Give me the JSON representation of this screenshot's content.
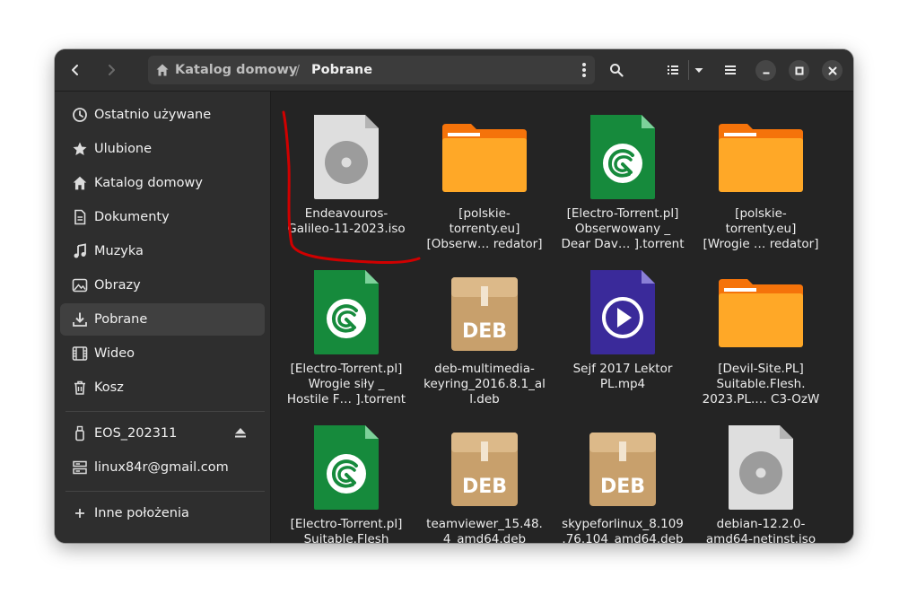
{
  "headerbar": {
    "back_icon": "chevron-left-icon",
    "forward_icon": "chevron-right-icon",
    "path": {
      "home": "Katalog domowy",
      "separator": "/",
      "current": "Pobrane"
    }
  },
  "sidebar": {
    "places": [
      {
        "label": "Ostatnio używane",
        "icon": "recent-icon"
      },
      {
        "label": "Ulubione",
        "icon": "star-icon"
      },
      {
        "label": "Katalog domowy",
        "icon": "home-icon"
      },
      {
        "label": "Dokumenty",
        "icon": "document-icon"
      },
      {
        "label": "Muzyka",
        "icon": "music-icon"
      },
      {
        "label": "Obrazy",
        "icon": "image-icon"
      },
      {
        "label": "Pobrane",
        "icon": "download-icon",
        "active": true
      },
      {
        "label": "Wideo",
        "icon": "video-icon"
      },
      {
        "label": "Kosz",
        "icon": "trash-icon"
      }
    ],
    "devices": [
      {
        "label": "EOS_202311",
        "icon": "usb-drive-icon",
        "eject": true
      },
      {
        "label": "linux84r@gmail.com",
        "icon": "network-account-icon"
      }
    ],
    "other": {
      "label": "Inne położenia",
      "icon": "plus-icon"
    }
  },
  "files": [
    {
      "name": "Endeavouros-\nGalileo-11-2023.iso",
      "type": "disc"
    },
    {
      "name": "[polskie-\ntorrenty.eu]\n[Obserw…  redator]",
      "type": "folder"
    },
    {
      "name": "[Electro-Torrent.pl]\nObserwowany _\nDear Dav… ].torrent",
      "type": "torrent"
    },
    {
      "name": "[polskie-\ntorrenty.eu]\n[Wrogie …  redator]",
      "type": "folder"
    },
    {
      "name": "[Electro-Torrent.pl]\nWrogie siły _\nHostile F… ].torrent",
      "type": "torrent"
    },
    {
      "name": "deb-multimedia-\nkeyring_2016.8.1_al\nl.deb",
      "type": "deb"
    },
    {
      "name": "Sejf  2017  Lektor\nPL.mp4",
      "type": "video"
    },
    {
      "name": "[Devil-Site.PL]\nSuitable.Flesh.\n2023.PL.…  C3-OzW",
      "type": "folder"
    },
    {
      "name": "[Electro-Torrent.pl]\nSuitable.Flesh",
      "type": "torrent"
    },
    {
      "name": "teamviewer_15.48.\n4_amd64.deb",
      "type": "deb"
    },
    {
      "name": "skypeforlinux_8.109\n.76.104_amd64.deb",
      "type": "deb"
    },
    {
      "name": "debian-12.2.0-\namd64-netinst.iso",
      "type": "disc"
    }
  ],
  "deb_label": "DEB",
  "colors": {
    "window_bg": "#242424",
    "sidebar_bg": "#2e2e2e",
    "folder": "#ffa827",
    "folder_tab": "#f5730a",
    "torrent_green": "#168a3c",
    "video_purple": "#3a2a9a",
    "deb_tan": "#c8a06c",
    "annotation_red": "#d00000"
  }
}
